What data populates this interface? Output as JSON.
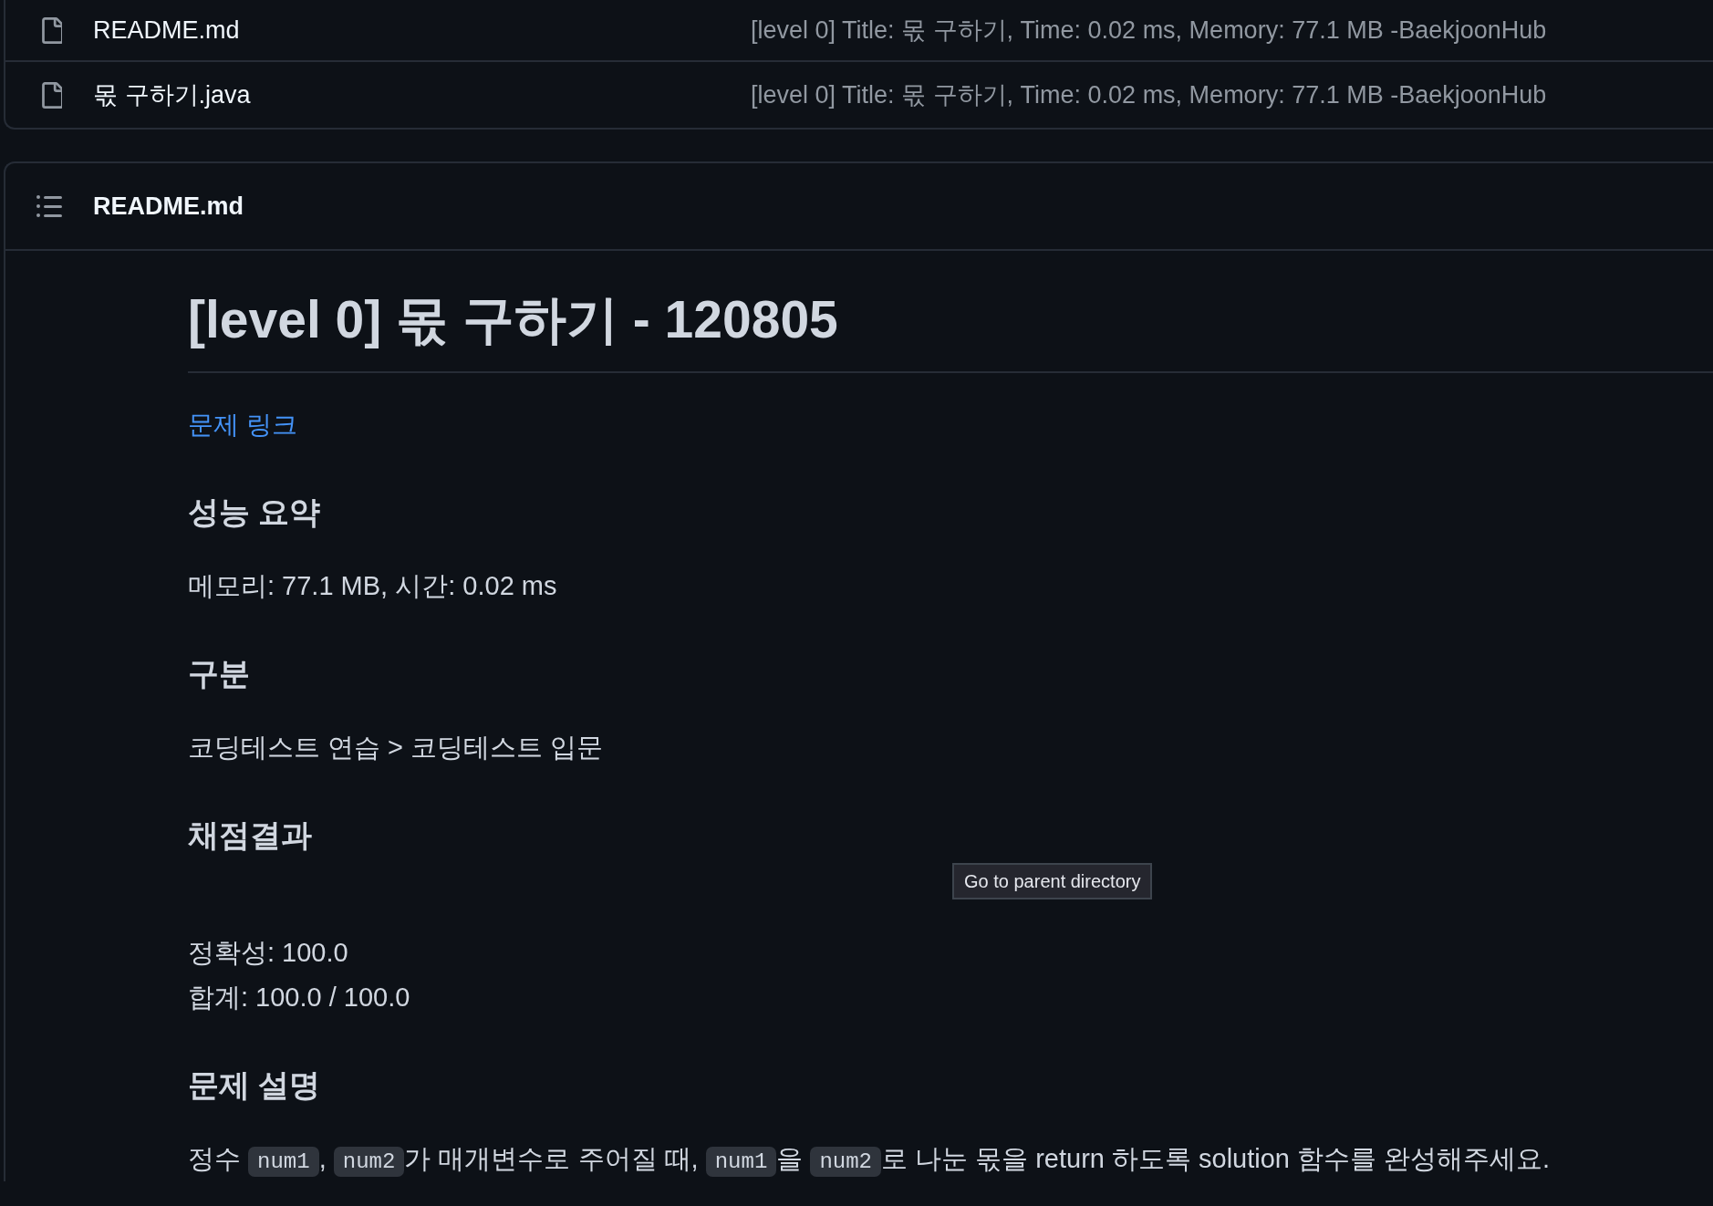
{
  "file_list": {
    "rows": [
      {
        "name": "README.md",
        "commit_message": "[level 0] Title: 몫 구하기, Time: 0.02 ms, Memory: 77.1 MB -BaekjoonHub"
      },
      {
        "name": "몫 구하기.java",
        "commit_message": "[level 0] Title: 몫 구하기, Time: 0.02 ms, Memory: 77.1 MB -BaekjoonHub"
      }
    ]
  },
  "readme": {
    "header_title": "README.md",
    "blocks": [
      {
        "kind": "heading1",
        "text": "[level 0] 몫 구하기 - 120805"
      },
      {
        "kind": "link",
        "text": "문제 링크"
      },
      {
        "kind": "heading3",
        "text": "성능 요약"
      },
      {
        "kind": "paragraph",
        "text": "메모리: 77.1 MB, 시간: 0.02 ms"
      },
      {
        "kind": "heading3",
        "text": "구분"
      },
      {
        "kind": "paragraph",
        "text": "코딩테스트 연습 > 코딩테스트 입문"
      },
      {
        "kind": "heading3",
        "text": "채점결과"
      },
      {
        "kind": "lines",
        "lines": [
          "정확성: 100.0",
          "합계: 100.0 / 100.0"
        ]
      },
      {
        "kind": "heading3",
        "text": "문제 설명"
      },
      {
        "kind": "rich_paragraph",
        "parts": [
          {
            "kind": "text",
            "text": "정수 "
          },
          {
            "kind": "code",
            "text": "num1"
          },
          {
            "kind": "text",
            "text": ", "
          },
          {
            "kind": "code",
            "text": "num2"
          },
          {
            "kind": "text",
            "text": "가 매개변수로 주어질 때, "
          },
          {
            "kind": "code",
            "text": "num1"
          },
          {
            "kind": "text",
            "text": "을 "
          },
          {
            "kind": "code",
            "text": "num2"
          },
          {
            "kind": "text",
            "text": "로 나눈 몫을 return 하도록 solution 함수를 완성해주세요."
          }
        ]
      }
    ]
  },
  "tooltip": {
    "text": "Go to parent directory"
  }
}
